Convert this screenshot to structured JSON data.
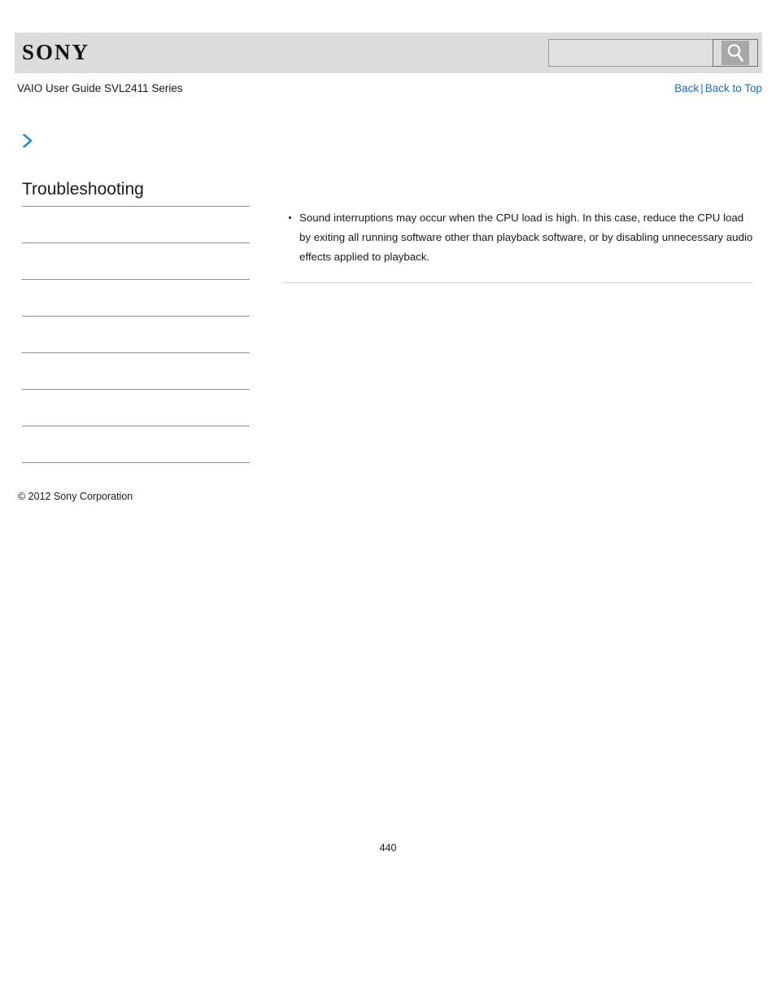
{
  "header": {
    "brand": "SONY",
    "search": {
      "value": "",
      "placeholder": "",
      "icon": "magnifier-icon"
    }
  },
  "breadcrumb": {
    "guide_title": "VAIO User Guide SVL2411 Series",
    "nav": {
      "back_label": "Back",
      "separator": "|",
      "back_to_top_label": "Back to Top"
    }
  },
  "content_marker": {
    "icon": "chevron-right-icon"
  },
  "sidebar": {
    "title": "Troubleshooting",
    "items": [
      {
        "label": ""
      },
      {
        "label": ""
      },
      {
        "label": ""
      },
      {
        "label": ""
      },
      {
        "label": ""
      },
      {
        "label": ""
      },
      {
        "label": ""
      }
    ]
  },
  "main": {
    "bullets": [
      "Sound interruptions may occur when the CPU load is high. In this case, reduce the CPU load by exiting all running software other than playback software, or by disabling unnecessary audio effects applied to playback."
    ]
  },
  "footer": {
    "copyright": "© 2012 Sony Corporation",
    "page_number": "440"
  },
  "colors": {
    "header_bg": "#dcdcdc",
    "link_blue": "#1c6bc4",
    "chevron_blue": "#2e86c8",
    "rule_gray": "#8e8e8e",
    "divider_gray": "#cfcfcf"
  }
}
